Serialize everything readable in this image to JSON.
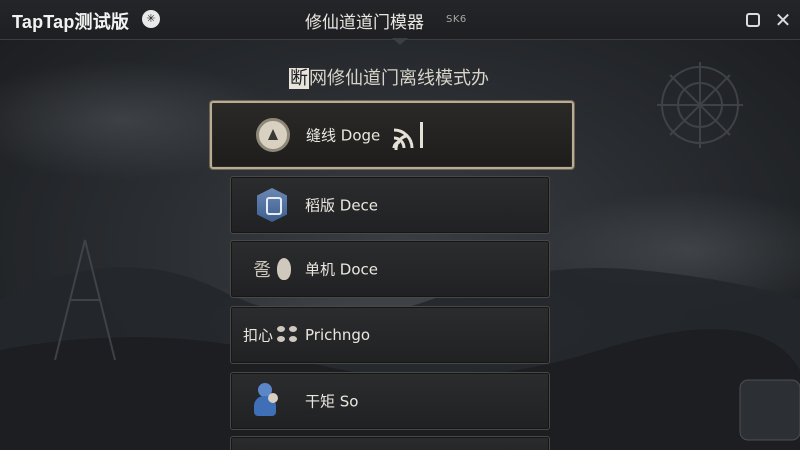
{
  "titlebar": {
    "brand": "TapTap测试版",
    "title": "修仙道道门模器",
    "subtitle": "SK6",
    "restore_label": "",
    "close_label": "✕"
  },
  "main": {
    "heading_highlight": "断",
    "heading_rest": "网修仙道门离线模式办"
  },
  "menu": {
    "items": [
      {
        "label": "缝线 Doge",
        "icon": "emblem-icon",
        "active": true,
        "indicator": "signal-icon"
      },
      {
        "label": "稻版 Dece",
        "icon": "shield-icon",
        "active": false
      },
      {
        "label": "单机 Doce",
        "icon_text": "卺",
        "icon": "drop-icon",
        "active": false
      },
      {
        "label": "扣心",
        "label2": "Prichngo",
        "icon": "dots-icon",
        "active": false
      },
      {
        "label": "干矩 So",
        "icon": "figure-icon",
        "active": false
      }
    ]
  },
  "colors": {
    "background": "#2a2d31",
    "border_active": "#b8ad92",
    "text": "#ebe7df",
    "shield_blue": "#3d5f8f"
  }
}
